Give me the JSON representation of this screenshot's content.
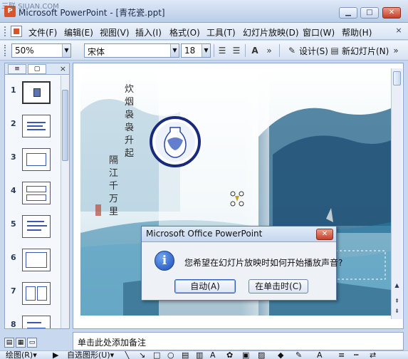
{
  "watermark": "三联 SJUAN.COM",
  "window": {
    "title": "Microsoft PowerPoint - [青花瓷.ppt]",
    "minimize": "▁",
    "maximize": "□",
    "close": "✕"
  },
  "menu": {
    "items": [
      "文件(F)",
      "编辑(E)",
      "视图(V)",
      "插入(I)",
      "格式(O)",
      "工具(T)",
      "幻灯片放映(D)",
      "窗口(W)",
      "帮助(H)"
    ],
    "doc_close": "×"
  },
  "toolbar": {
    "zoom": "50%",
    "font": "宋体",
    "font_size": "18",
    "design_label": "设计(S)",
    "new_slide_label": "新幻灯片(N)"
  },
  "left_pane": {
    "tab_outline": "≡",
    "tab_slides": "▢",
    "close": "×",
    "slide_numbers": [
      "1",
      "2",
      "3",
      "4",
      "5",
      "6",
      "7",
      "8"
    ]
  },
  "slide": {
    "poem_line1": "炊烟袅袅升起",
    "poem_line2": "隔江千万里"
  },
  "notes_placeholder": "单击此处添加备注",
  "drawbar": {
    "draw_label": "绘图(R)▾",
    "autoshape_label": "自选图形(U)▾"
  },
  "dialog": {
    "title": "Microsoft Office PowerPoint",
    "message": "您希望在幻灯片放映时如何开始播放声音?",
    "btn_auto": "自动(A)",
    "btn_click": "在单击时(C)",
    "close": "✕",
    "icon": "i"
  }
}
